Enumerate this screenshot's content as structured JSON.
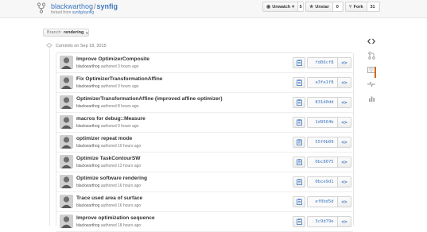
{
  "repo": {
    "owner": "blackwarthog",
    "separator": "/",
    "name": "synfig",
    "forked_prefix": "forked from",
    "forked_from": "synfig/synfig"
  },
  "actions": {
    "unwatch": {
      "label": "Unwatch",
      "count": "5"
    },
    "unstar": {
      "label": "Unstar",
      "count": "0"
    },
    "fork": {
      "label": "Fork",
      "count": "31"
    }
  },
  "branch": {
    "label": "Branch:",
    "value": "rendering"
  },
  "timeline": {
    "date_label": "Commits on Sep 18, 2015"
  },
  "commits": [
    {
      "title": "Improve OptimizerComposite",
      "author": "blackwarthog",
      "meta": "authored 3 hours ago",
      "sha": "fd06cf8"
    },
    {
      "title": "Fix OptimizerTransformationAffine",
      "author": "blackwarthog",
      "meta": "authored 3 hours ago",
      "sha": "a3fe1f8"
    },
    {
      "title": "OptimizerTransformationAffine (improved affine optimizer)",
      "author": "blackwarthog",
      "meta": "authored 8 hours ago",
      "sha": "831d0dd"
    },
    {
      "title": "macros for debug::Measure",
      "author": "blackwarthog",
      "meta": "authored 9 hours ago",
      "sha": "1d9564b"
    },
    {
      "title": "optimizer repeat mode",
      "author": "blackwarthog",
      "meta": "authored 10 hours ago",
      "sha": "55f0b09"
    },
    {
      "title": "Optimize TaskContourSW",
      "author": "blackwarthog",
      "meta": "authored 13 hours ago",
      "sha": "0bc8075"
    },
    {
      "title": "Optimize software rendering",
      "author": "blackwarthog",
      "meta": "authored 16 hours ago",
      "sha": "0bce9d1"
    },
    {
      "title": "Trace used area of surface",
      "author": "blackwarthog",
      "meta": "authored 16 hours ago",
      "sha": "ef0bd5d"
    },
    {
      "title": "Improve optimization sequence",
      "author": "blackwarthog",
      "meta": "authored 18 hours ago",
      "sha": "3c9d79e"
    }
  ],
  "browse_label": "<>",
  "colors": {
    "link": "#4078c0",
    "accent": "#d26911"
  },
  "icons": {
    "repo": "repo-forked-icon",
    "copy": "clipboard-icon",
    "commits": "git-commit-icon"
  }
}
